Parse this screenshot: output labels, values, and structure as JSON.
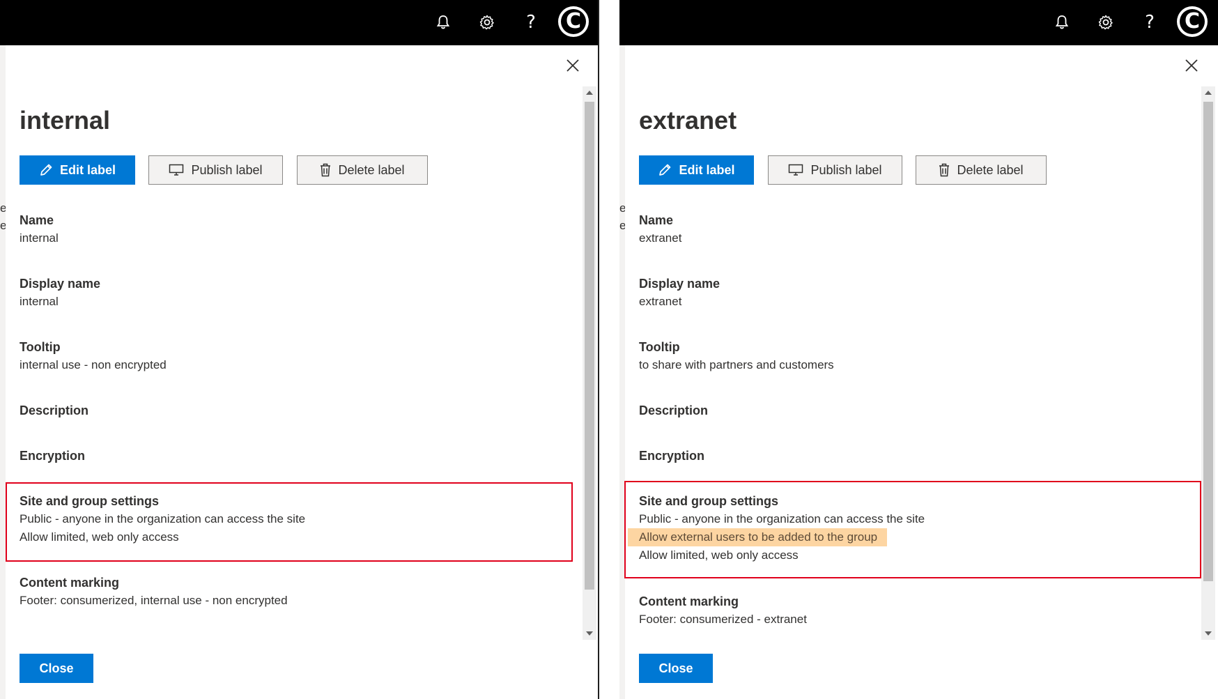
{
  "left": {
    "title": "internal",
    "buttons": {
      "edit": "Edit label",
      "publish": "Publish label",
      "delete": "Delete label"
    },
    "fields": {
      "name_label": "Name",
      "name_value": "internal",
      "display_label": "Display name",
      "display_value": "internal",
      "tooltip_label": "Tooltip",
      "tooltip_value": "internal use - non encrypted",
      "description_label": "Description",
      "encryption_label": "Encryption",
      "site_label": "Site and group settings",
      "site_line1": "Public - anyone in the organization can access the site",
      "site_line2": "Allow limited, web only access",
      "marking_label": "Content marking",
      "marking_value": "Footer: consumerized, internal use - non encrypted"
    },
    "close": "Close",
    "bg_chars": [
      "e",
      "e"
    ]
  },
  "right": {
    "title": "extranet",
    "buttons": {
      "edit": "Edit label",
      "publish": "Publish label",
      "delete": "Delete label"
    },
    "fields": {
      "name_label": "Name",
      "name_value": "extranet",
      "display_label": "Display name",
      "display_value": "extranet",
      "tooltip_label": "Tooltip",
      "tooltip_value": "to share with partners and customers",
      "description_label": "Description",
      "encryption_label": "Encryption",
      "site_label": "Site and group settings",
      "site_line1": "Public - anyone in the organization can access the site",
      "site_line2": "Allow external users to be added to the group",
      "site_line3": "Allow limited, web only access",
      "marking_label": "Content marking",
      "marking_value": "Footer: consumerized - extranet"
    },
    "close": "Close",
    "bg_chars": [
      "e",
      "e"
    ]
  },
  "topbar_icons": [
    "bell-icon",
    "gear-icon",
    "help-icon",
    "avatar"
  ],
  "avatar_letter": "C",
  "colors": {
    "accent": "#0078d4",
    "highlight_box": "#e0001b",
    "highlight_text_bg": "#fdd5a2",
    "topbar": "#000000"
  }
}
